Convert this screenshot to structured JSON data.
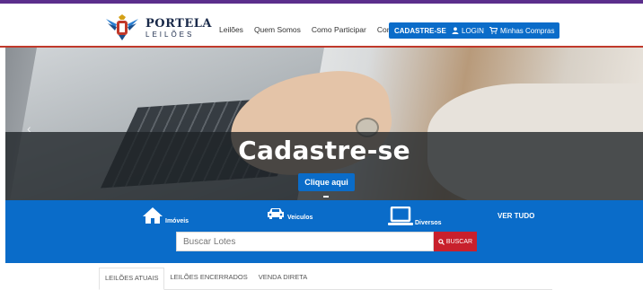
{
  "header": {
    "logo": {
      "name": "PORTELA",
      "sub": "LEILÕES"
    },
    "nav": [
      {
        "label": "Leilões"
      },
      {
        "label": "Quem Somos"
      },
      {
        "label": "Como Participar"
      },
      {
        "label": "Contato"
      }
    ],
    "buttons": {
      "cadastre": "CADASTRE-SE",
      "login": "LOGIN",
      "compras": "Minhas Compras"
    }
  },
  "hero": {
    "title": "Cadastre-se",
    "cta": "Clique aqui"
  },
  "categories": [
    {
      "label": "Imóveis",
      "icon": "house-icon"
    },
    {
      "label": "Veiculos",
      "icon": "car-icon"
    },
    {
      "label": "Diversos",
      "icon": "laptop-icon"
    }
  ],
  "ver_tudo": "VER TUDO",
  "search": {
    "placeholder": "Buscar Lotes",
    "button": "BUSCAR"
  },
  "tabs": [
    {
      "label": "LEILÕES ATUAIS",
      "active": true
    },
    {
      "label": "LEILÕES ENCERRADOS",
      "active": false
    },
    {
      "label": "VENDA DIRETA",
      "active": false
    }
  ],
  "colors": {
    "primary": "#0a6cc9",
    "accent_red": "#c8202c",
    "top_bar": "#5b2e8c"
  }
}
